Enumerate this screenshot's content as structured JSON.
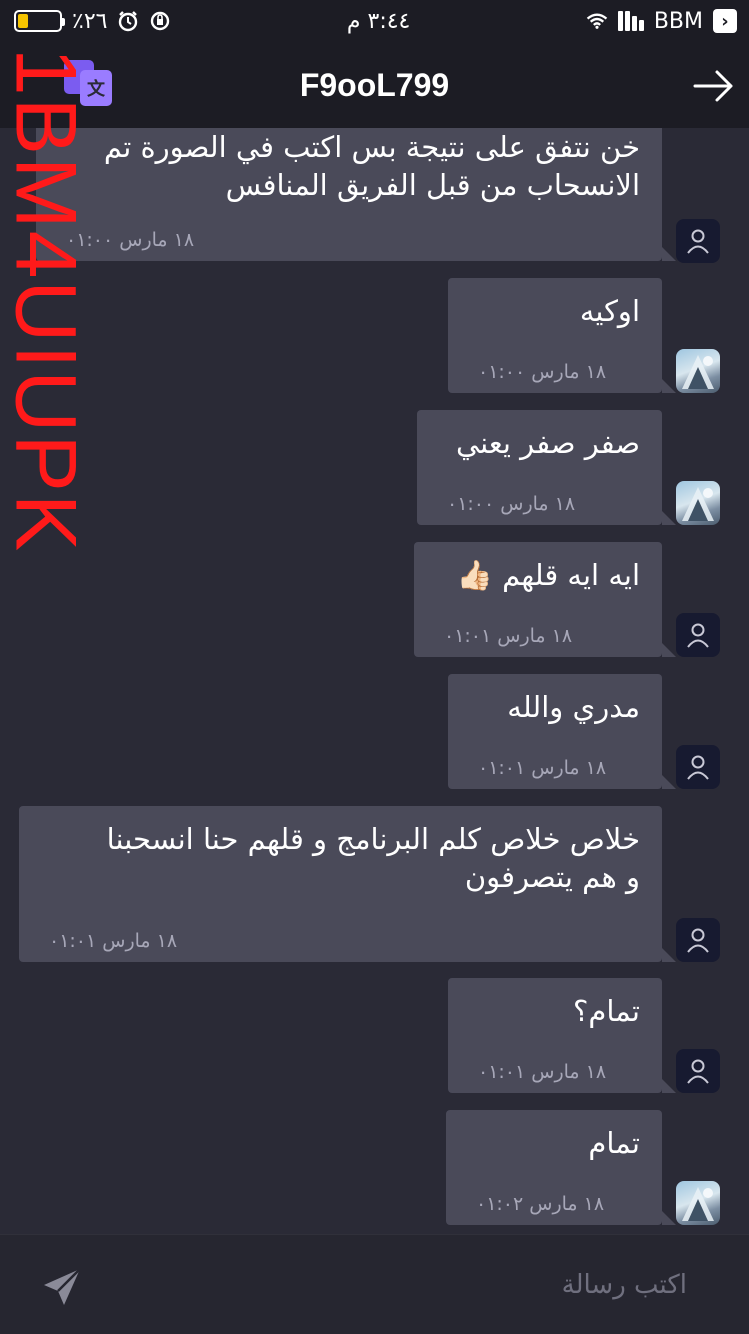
{
  "status_bar": {
    "battery_percent": "٪٢٦",
    "battery_level": 0.26,
    "time": "٣:٤٤ م",
    "carrier": "BBM"
  },
  "header": {
    "title": "F9ooL799",
    "translate_icon": "translate-icon",
    "back_icon": "arrow-right-icon"
  },
  "watermark": "1BM4UIUPK",
  "messages": [
    {
      "text_lines": [
        "خن نتفق على نتيجة بس اكتب في الصورة تم",
        "الانسحاب من قبل الفريق المنافس"
      ],
      "time": "١٨ مارس ٠١:٠٠",
      "avatar": "default"
    },
    {
      "text_lines": [
        "اوكيه"
      ],
      "time": "١٨ مارس ٠١:٠٠",
      "avatar": "photo"
    },
    {
      "text_lines": [
        "صفر صفر يعني"
      ],
      "time": "١٨ مارس ٠١:٠٠",
      "avatar": "photo"
    },
    {
      "text_lines": [
        "ايه ايه قلهم 👍🏻"
      ],
      "time": "١٨ مارس ٠١:٠١",
      "avatar": "default"
    },
    {
      "text_lines": [
        "مدري والله"
      ],
      "time": "١٨ مارس ٠١:٠١",
      "avatar": "default"
    },
    {
      "text_lines": [
        "خلاص خلاص كلم البرنامج و قلهم حنا انسحبنا",
        "و هم يتصرفون"
      ],
      "time": "١٨ مارس ٠١:٠١",
      "avatar": "default"
    },
    {
      "text_lines": [
        "تمام؟"
      ],
      "time": "١٨ مارس ٠١:٠١",
      "avatar": "default"
    },
    {
      "text_lines": [
        "تمام"
      ],
      "time": "١٨ مارس ٠١:٠٢",
      "avatar": "photo"
    }
  ],
  "composer": {
    "placeholder": "اكتب رسالة",
    "value": "",
    "send_icon": "send-icon"
  },
  "colors": {
    "background": "#2a2a36",
    "bar": "#1c1c24",
    "bubble": "#4a4a59",
    "time_text": "#a7a7b8",
    "watermark": "#ff1a1a",
    "accent": "#9a7cff"
  }
}
